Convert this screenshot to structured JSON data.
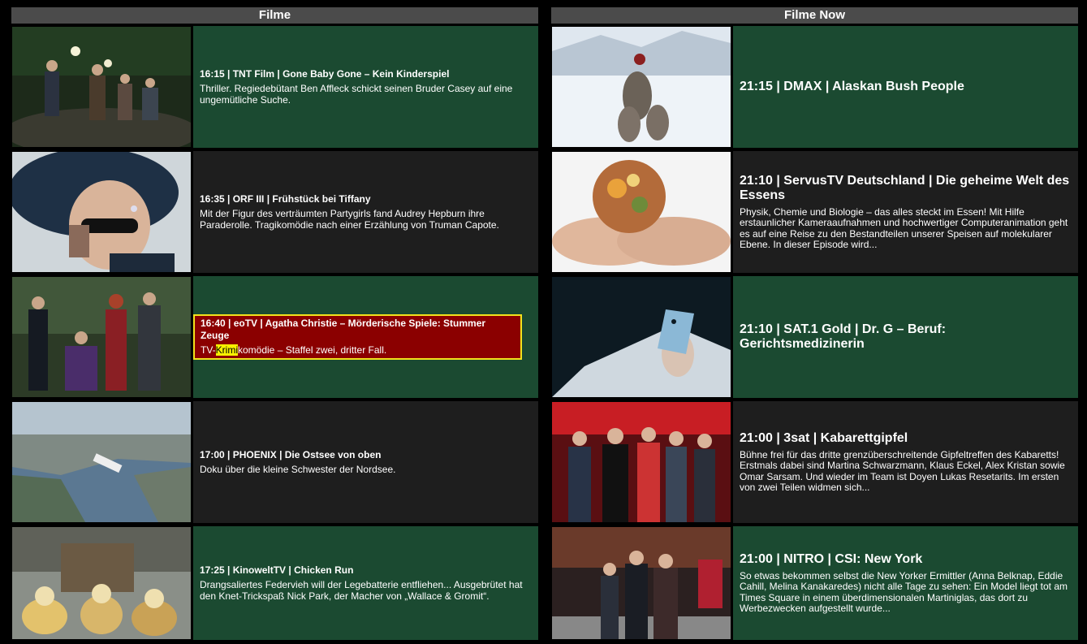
{
  "left": {
    "header": "Filme",
    "items": [
      {
        "title": "16:15 | TNT Film | Gone Baby Gone – Kein Kinderspiel",
        "desc": "Thriller. Regiedebütant Ben Affleck schickt seinen Bruder Casey auf eine ungemütliche Suche.",
        "bg": "green"
      },
      {
        "title": "16:35 | ORF III | Frühstück bei Tiffany",
        "desc": "Mit der Figur des verträumten Partygirls fand Audrey Hepburn ihre Paraderolle. Tragikomödie nach einer Erzählung von Truman Capote.",
        "bg": "dark"
      },
      {
        "title": "16:40 | eoTV | Agatha Christie – Mörderische Spiele: Stummer Zeuge",
        "desc_pre": "TV-",
        "desc_hl": "Krimi",
        "desc_post": "komödie – Staffel zwei, dritter Fall.",
        "bg": "green",
        "selected": true
      },
      {
        "title": "17:00 | PHOENIX | Die Ostsee von oben",
        "desc": "Doku über die kleine Schwester der Nordsee.",
        "bg": "dark"
      },
      {
        "title": "17:25 | KinoweltTV | Chicken Run",
        "desc": "Drangsaliertes Federvieh will der Legebatterie entfliehen... Ausgebrütet hat den Knet-Trickspaß Nick Park, der Macher von „Wallace & Gromit“.",
        "bg": "green"
      }
    ]
  },
  "right": {
    "header": "Filme Now",
    "items": [
      {
        "title": "21:15 | DMAX | Alaskan Bush People",
        "desc": "",
        "bg": "green"
      },
      {
        "title": "21:10 | ServusTV Deutschland | Die geheime Welt des Essens",
        "desc": "Physik, Chemie und Biologie – das alles steckt im Essen! Mit Hilfe erstaunlicher Kameraaufnahmen und hochwertiger Computeranimation geht es auf eine Reise zu den Bestandteilen unserer Speisen auf molekularer Ebene. In dieser Episode wird...",
        "bg": "dark"
      },
      {
        "title": "21:10 | SAT.1 Gold | Dr. G – Beruf: Gerichtsmedizinerin",
        "desc": "",
        "bg": "green"
      },
      {
        "title": "21:00 | 3sat | Kabarettgipfel",
        "desc": "Bühne frei für das dritte grenzüberschreitende Gipfeltreffen des Kabaretts! Erstmals dabei sind Martina Schwarzmann, Klaus Eckel, Alex Kristan sowie Omar Sarsam. Und wieder im Team ist Doyen Lukas Resetarits. Im ersten von zwei Teilen widmen sich...",
        "bg": "dark"
      },
      {
        "title": "21:00 | NITRO | CSI: New York",
        "desc": "So etwas bekommen selbst die New Yorker Ermittler (Anna Belknap, Eddie Cahill, Melina Kanakaredes) nicht alle Tage zu sehen: Ein Model liegt tot am Times Square in einem überdimensionalen Martiniglas, das dort zu Werbezwecken aufgestellt wurde...",
        "bg": "green"
      }
    ]
  },
  "colors": {
    "green": "#1b4a31",
    "dark": "#1e1e1e",
    "header": "#4b4b4b",
    "selected_bg": "#8b0000",
    "selected_border": "#f2e21c",
    "highlight": "#f7f000"
  }
}
